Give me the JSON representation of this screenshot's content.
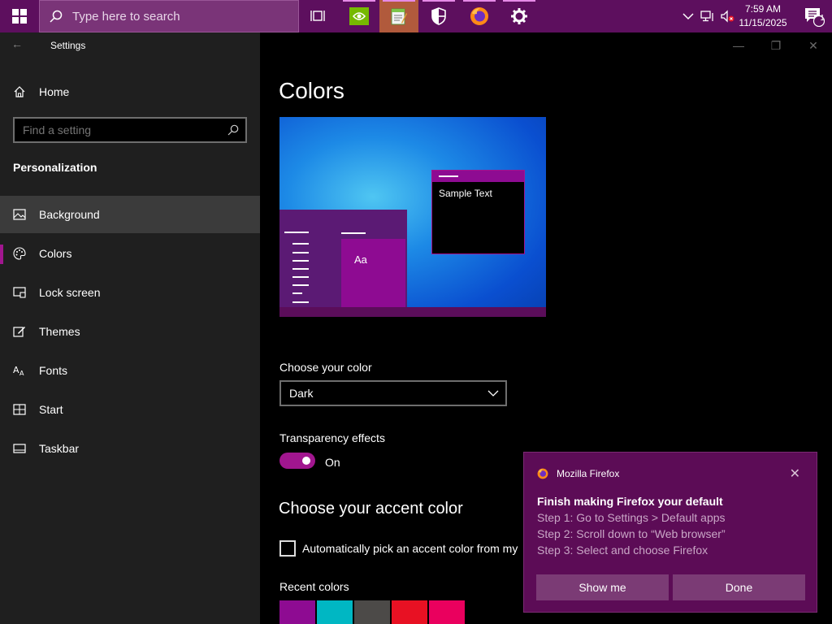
{
  "taskbar": {
    "search_placeholder": "Type here to search",
    "pinned": [
      "task-view",
      "nvidia",
      "notepad",
      "security",
      "firefox",
      "settings"
    ],
    "clock_time": "7:59 AM",
    "clock_date": "11/15/2025",
    "notification_count": "1",
    "colors": {
      "bg": "#5d0f5e",
      "active": "#b15a3c"
    }
  },
  "window": {
    "title": "Settings"
  },
  "sidebar": {
    "home_label": "Home",
    "search_placeholder": "Find a setting",
    "section": "Personalization",
    "items": [
      {
        "label": "Background",
        "icon": "picture-icon",
        "state": "hover"
      },
      {
        "label": "Colors",
        "icon": "palette-icon",
        "state": "selected"
      },
      {
        "label": "Lock screen",
        "icon": "lock-screen-icon"
      },
      {
        "label": "Themes",
        "icon": "themes-icon"
      },
      {
        "label": "Fonts",
        "icon": "fonts-icon"
      },
      {
        "label": "Start",
        "icon": "start-icon"
      },
      {
        "label": "Taskbar",
        "icon": "taskbar-icon"
      }
    ]
  },
  "main": {
    "title": "Colors",
    "preview": {
      "sample_text": "Sample Text",
      "aa": "Aa"
    },
    "choose_color_label": "Choose your color",
    "choose_color_value": "Dark",
    "transparency_label": "Transparency effects",
    "transparency_state": "On",
    "accent_heading": "Choose your accent color",
    "auto_pick_label": "Automatically pick an accent color from my",
    "recent_colors_label": "Recent colors",
    "recent_colors": [
      "#8e0b92",
      "#00b7c3",
      "#4c4a48",
      "#e81123",
      "#ea005e"
    ],
    "accent": "#a1168f"
  },
  "toast": {
    "app": "Mozilla Firefox",
    "title": "Finish making Firefox your default",
    "steps": [
      "Step 1: Go to Settings > Default apps",
      "Step 2: Scroll down to “Web browser”",
      "Step 3: Select and choose Firefox"
    ],
    "buttons": [
      "Show me",
      "Done"
    ]
  }
}
